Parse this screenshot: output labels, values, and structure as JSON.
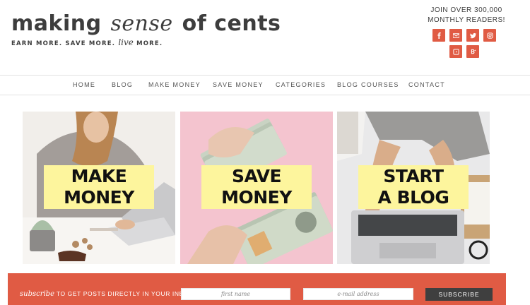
{
  "header": {
    "logo": {
      "word1": "making",
      "word2": "sense",
      "word3": "of cents"
    },
    "tagline": {
      "part1": "EARN MORE. SAVE MORE.",
      "part2": "live",
      "part3": "MORE."
    },
    "join_line1": "JOIN OVER 300,000",
    "join_line2": "MONTHLY READERS!",
    "social": [
      "facebook-icon",
      "email-icon",
      "twitter-icon",
      "instagram-icon",
      "pinterest-icon",
      "bloglovin-icon"
    ],
    "social_color": "#e05b44"
  },
  "nav": {
    "items": [
      "HOME",
      "BLOG",
      "MAKE MONEY",
      "SAVE MONEY",
      "CATEGORIES",
      "BLOG COURSES",
      "CONTACT"
    ]
  },
  "tiles": [
    {
      "line1": "MAKE",
      "line2": "MONEY"
    },
    {
      "line1": "SAVE",
      "line2": "MONEY"
    },
    {
      "line1": "START",
      "line2": "A BLOG"
    }
  ],
  "subscribe": {
    "script": "subscribe",
    "text": "TO GET POSTS DIRECTLY IN YOUR INBOX!",
    "first_name_placeholder": "first name",
    "email_placeholder": "e-mail address",
    "button": "SUBSCRIBE",
    "bar_color": "#e05b44"
  }
}
